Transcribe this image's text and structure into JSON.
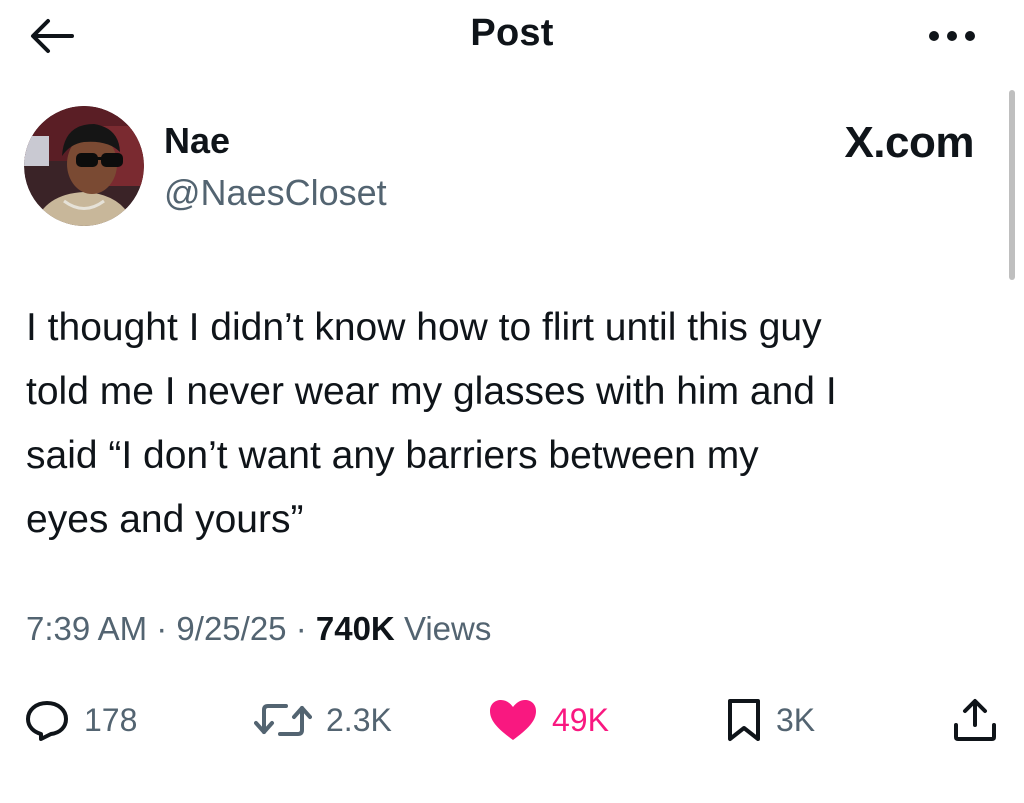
{
  "header": {
    "title": "Post",
    "back_icon": "arrow-left-icon",
    "more_icon": "more-horizontal-icon"
  },
  "author": {
    "display_name": "Nae",
    "handle": "@NaesCloset",
    "avatar": "profile-photo"
  },
  "watermark": "X.com",
  "post": {
    "text": "I thought I didn’t know how to flirt until this guy\ntold me I never wear my glasses with him and I\nsaid “I don’t want any barriers between my\neyes and yours”",
    "time": "7:39 AM",
    "date": "9/25/25",
    "views_count": "740K",
    "views_label": "Views",
    "separator": "·"
  },
  "actions": {
    "replies": "178",
    "reposts": "2.3K",
    "likes": "49K",
    "bookmarks": "3K"
  },
  "colors": {
    "text": "#0f1419",
    "secondary": "#536471",
    "like": "#f91880",
    "scrollbar": "#bfbfbf"
  }
}
